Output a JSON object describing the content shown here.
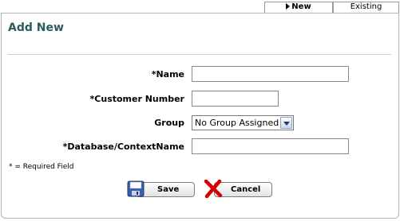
{
  "tabs": {
    "new": "New",
    "existing": "Existing"
  },
  "page": {
    "title": "Add New"
  },
  "form": {
    "name_label": "*Name",
    "name_value": "",
    "customer_number_label": "*Customer Number",
    "customer_number_value": "",
    "group_label": "Group",
    "group_selected": "No Group Assigned",
    "database_label": "*Database/ContextName",
    "database_value": "",
    "required_note": "* = Required Field"
  },
  "buttons": {
    "save": "Save",
    "cancel": "Cancel",
    "save_icon": "floppy-disk-icon",
    "cancel_icon": "red-x-icon"
  },
  "colors": {
    "title": "#2a5c5a",
    "cancel_x": "#d60000",
    "save_icon": "#3b5fb0"
  }
}
